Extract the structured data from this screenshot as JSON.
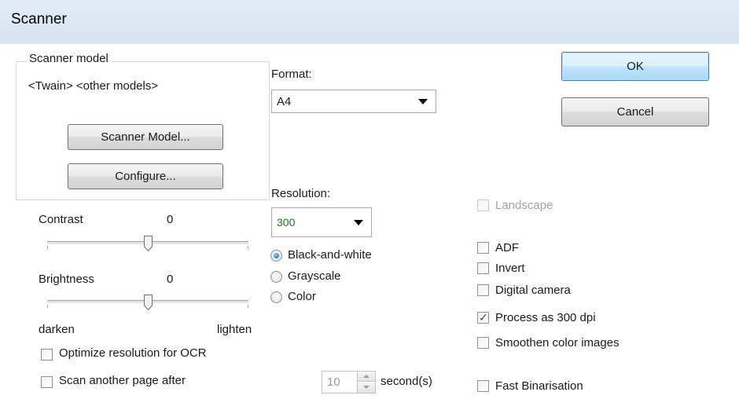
{
  "window": {
    "title": "Scanner"
  },
  "scanner_model": {
    "group_label": "Scanner model",
    "current": "<Twain> <other models>",
    "scanner_model_button": "Scanner Model...",
    "configure_button": "Configure..."
  },
  "format": {
    "label": "Format:",
    "selected": "A4"
  },
  "resolution": {
    "label": "Resolution:",
    "selected": "300",
    "value_color": "#1a7a1a"
  },
  "color_mode": {
    "options": [
      "Black-and-white",
      "Grayscale",
      "Color"
    ],
    "selected": "Black-and-white"
  },
  "contrast": {
    "label": "Contrast",
    "value": "0",
    "level": 0.5
  },
  "brightness": {
    "label": "Brightness",
    "value": "0",
    "level": 0.5
  },
  "scale_labels": {
    "left": "darken",
    "right": "lighten"
  },
  "options_left": {
    "optimize_ocr": {
      "label": "Optimize resolution for OCR",
      "checked": false
    },
    "scan_another": {
      "label": "Scan another page after",
      "checked": false
    }
  },
  "delay": {
    "value": "10",
    "unit": "second(s)"
  },
  "checkboxes_right": {
    "landscape": {
      "label": "Landscape",
      "checked": false,
      "disabled": true
    },
    "adf": {
      "label": "ADF",
      "checked": false
    },
    "invert": {
      "label": "Invert",
      "checked": false
    },
    "digital_camera": {
      "label": "Digital camera",
      "checked": false
    },
    "process_300": {
      "label": "Process as 300 dpi",
      "checked": true
    },
    "smoothen": {
      "label": "Smoothen color images",
      "checked": false
    },
    "fast_binarisation": {
      "label": "Fast Binarisation",
      "checked": false
    }
  },
  "buttons": {
    "ok": "OK",
    "cancel": "Cancel"
  },
  "icons": {
    "check": "checkmark-icon",
    "dropdown": "chevron-down-icon"
  }
}
